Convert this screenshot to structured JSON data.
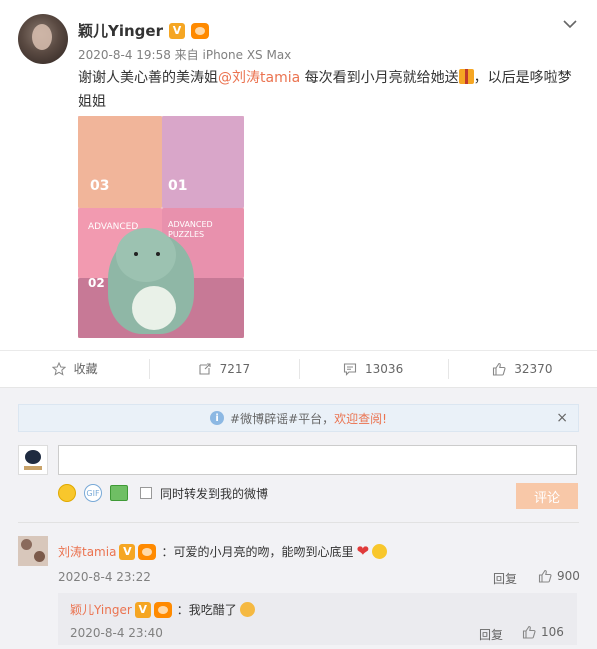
{
  "post": {
    "author": "颖儿Yinger",
    "verified_mark": "V",
    "meta": "2020-8-4 19:58 来自 iPhone XS Max",
    "text_before": "谢谢人美心善的美涛姐",
    "mention": "@刘涛tamia",
    "text_middle": " 每次看到小月亮就给她送",
    "text_after": "，以后是哆啦梦姐姐",
    "icons": {
      "menu": "chevron-down-icon",
      "gift": "gift-icon"
    },
    "photo_box_labels": [
      "03",
      "01",
      "ADVANCED",
      "ADVANCED PUZZLES",
      "02"
    ]
  },
  "actions": {
    "favorite_label": "收藏",
    "repost_count": "7217",
    "comment_count": "13036",
    "like_count": "32370"
  },
  "comment_box": {
    "notice_text": "#微博辟谣#平台，",
    "notice_link": "欢迎查阅!",
    "notice_close": "×",
    "input_placeholder": "",
    "repost_label": "同时转发到我的微博",
    "submit_label": "评论"
  },
  "comments": [
    {
      "author": "刘涛tamia",
      "verified_mark": "V",
      "text": "：可爱的小月亮的吻，能吻到心底里",
      "time": "2020-8-4 23:22",
      "reply_label": "回复",
      "likes": "900",
      "replies": [
        {
          "author": "颖儿Yinger",
          "verified_mark": "V",
          "text": "：我吃醋了",
          "time": "2020-8-4 23:40",
          "reply_label": "回复",
          "likes": "106"
        }
      ]
    }
  ],
  "colors": {
    "accent": "#eb7350",
    "verified": "#f5a623",
    "submit_disabled": "#f8c8a8",
    "notice_bg": "#eaf1f8"
  }
}
